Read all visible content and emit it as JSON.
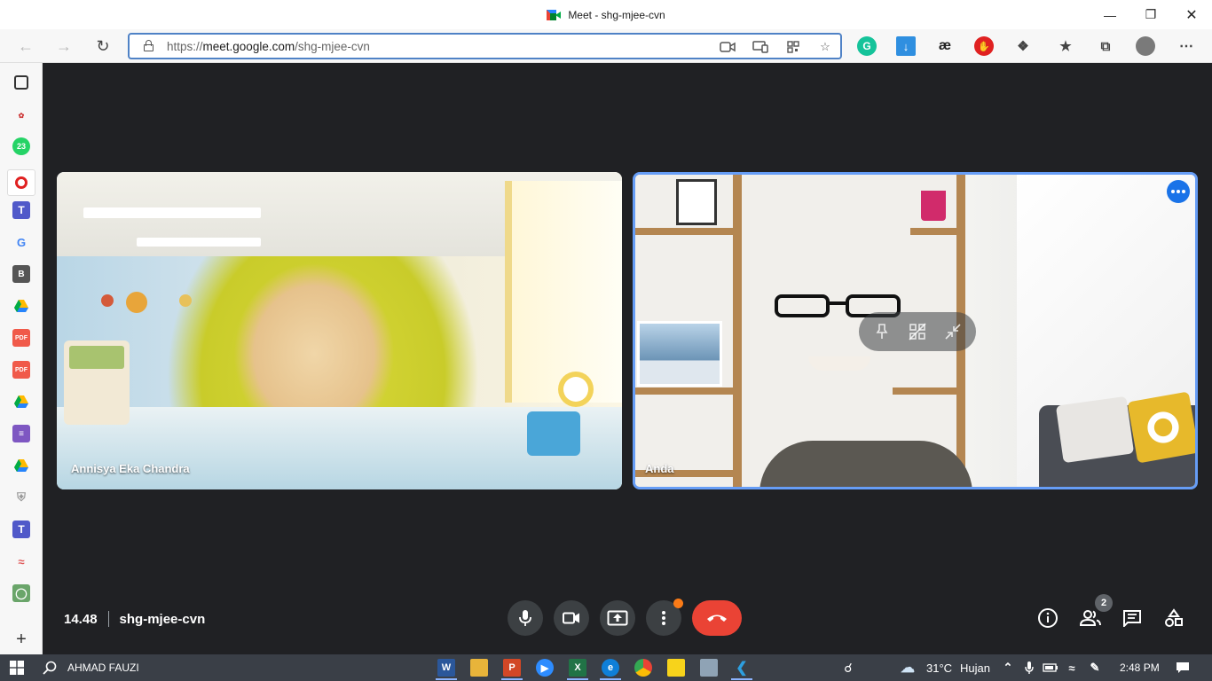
{
  "window": {
    "title": "Meet - shg-mjee-cvn",
    "controls": [
      "minimize",
      "maximize",
      "close"
    ]
  },
  "browser": {
    "url_prefix": "https://",
    "url_host": "meet.google.com",
    "url_path": "/shg-mjee-cvn",
    "nav": [
      "back",
      "forward",
      "refresh"
    ]
  },
  "sidebar": {
    "badge_count": "23",
    "add_icon": "+"
  },
  "tiles": [
    {
      "name": "Annisya Eka Chandra"
    },
    {
      "name": "Anda"
    }
  ],
  "meeting": {
    "time": "14.48",
    "code": "shg-mjee-cvn",
    "participants_count": "2"
  },
  "taskbar": {
    "user": "AHMAD FAUZI",
    "temperature": "31°C",
    "weather": "Hujan",
    "clock": "2:48 PM"
  },
  "colors": {
    "meet_bg": "#202124",
    "control_bg": "#3c4043",
    "end_call": "#ea4335",
    "active_border": "#669df6",
    "accent_blue": "#1a73e8",
    "notify_orange": "#fa7b17"
  }
}
